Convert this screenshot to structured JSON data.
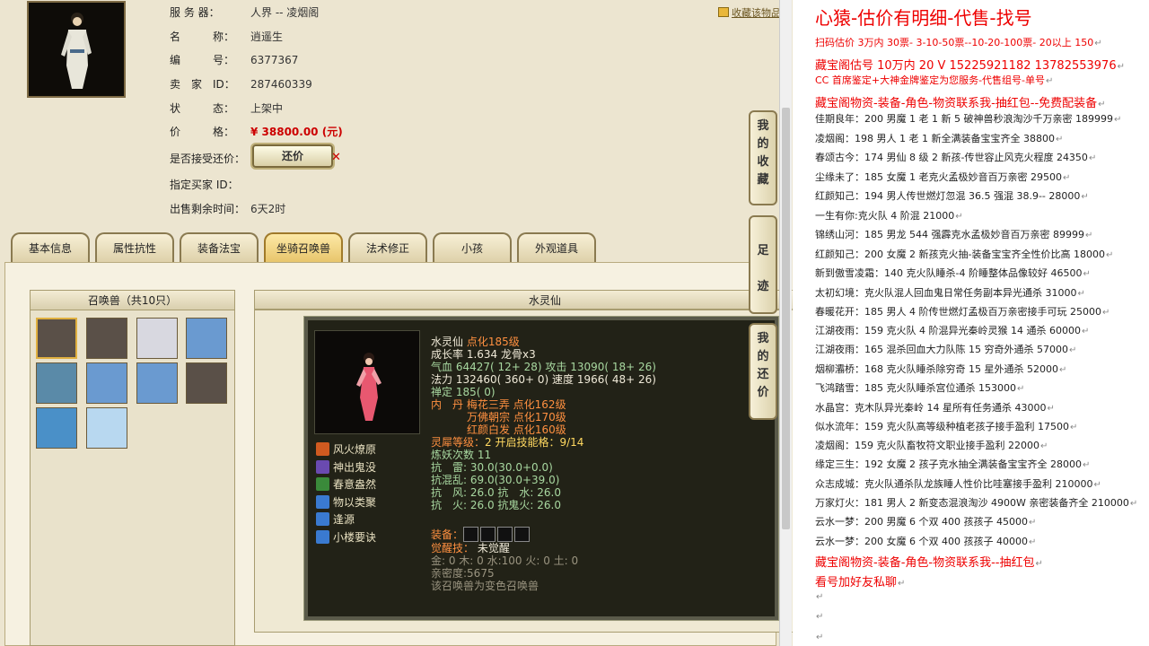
{
  "favorite_link": "收藏该物品",
  "char_info": {
    "server": {
      "label": "服 务 器：",
      "value": "人界 -- 凌烟阁"
    },
    "name": {
      "label": "名　　　称：",
      "value": "逍遥生"
    },
    "number": {
      "label": "编　　　号：",
      "value": "6377367"
    },
    "seller": {
      "label": "卖　家　ID：",
      "value": "287460339"
    },
    "status": {
      "label": "状　　　态：",
      "value": "上架中"
    },
    "price": {
      "label": "价　　　格：",
      "value": "¥ 38800.00 (元)"
    },
    "counter_offer": {
      "label": "是否接受还价：",
      "button": "还价"
    },
    "buyer": {
      "label": "指定买家 ID：",
      "value": ""
    },
    "remaining": {
      "label": "出售剩余时间：",
      "value": "6天2时"
    }
  },
  "tabs": [
    "基本信息",
    "属性抗性",
    "装备法宝",
    "坐骑召唤兽",
    "法术修正",
    "小孩",
    "外观道具"
  ],
  "active_tab": "坐骑召唤兽",
  "side_tabs": [
    {
      "label": "我的收藏",
      "chars": [
        "我",
        "的",
        "收",
        "藏"
      ]
    },
    {
      "label": "足迹",
      "chars": [
        "足",
        "迹"
      ]
    },
    {
      "label": "我的还价",
      "chars": [
        "我",
        "的",
        "还",
        "价"
      ]
    }
  ],
  "pets": {
    "title": "召唤兽（共10只）",
    "count": 10
  },
  "detail": {
    "title": "水灵仙",
    "name": "水灵仙",
    "level": "点化185级",
    "growth": "成长率 1.634 龙骨x3",
    "hp": "气血 64427( 12+ 28)",
    "attack": "攻击 13090( 18+ 26)",
    "mp": "法力 132460( 360+ 0)",
    "speed": "速度 1966( 48+ 26)",
    "ding": "禅定 185( 0)",
    "dan_label": "内　丹",
    "dan1": "梅花三弄 点化162级",
    "dan2": "万佛朝宗 点化170级",
    "dan3": "红颜白发 点化160级",
    "lingshou_label": "灵犀等级：",
    "lingshou_value": "2 开启技能格：9/14",
    "lianyao": "炼妖次数 11",
    "res1": "抗　雷: 30.0(30.0+0.0)",
    "res2": "抗混乱: 69.0(30.0+39.0)",
    "res3": "抗　风: 26.0  抗　水: 26.0",
    "res4": "抗　火: 26.0  抗鬼火: 26.0",
    "equip_label": "装备：",
    "awake_label": "觉醒技：",
    "awake_value": "未觉醒",
    "elements": "金: 0 木: 0 水:100 火: 0 土: 0",
    "intimacy": "亲密度:5675",
    "note": "该召唤兽为变色召唤兽",
    "skills": [
      "风火燎原",
      "神出鬼没",
      "春意盎然",
      "物以类聚",
      "逢源",
      "小楼要诀"
    ],
    "skill_colors": [
      "#d05a20",
      "#6a4ab0",
      "#3a8a3a",
      "#3a7ad0",
      "#3a7ad0",
      "#3a7ad0"
    ]
  },
  "right_panel": {
    "header": "心猿-估价有明细-代售-找号",
    "watermark": "",
    "lines": [
      {
        "text": "扫码估价 3万内 30票- 3-10-50票--10-20-100票-  20以上 150",
        "style": "red"
      },
      {
        "text": "藏宝阁估号 10万内 20 V 15225921182   13782553976",
        "style": "red mid"
      },
      {
        "text": "CC 首席鉴定+大神金牌鉴定为您服务-代售组号-单号",
        "style": "red"
      },
      {
        "text": "藏宝阁物资-装备-角色-物资联系我-抽红包--免费配装备",
        "style": "red mid"
      },
      {
        "text": "佳期良年：200 男魔 1 老 1 新 5 破神兽秒浪淘沙千万亲密 189999",
        "style": ""
      },
      {
        "text": "凌烟阁：198 男人 1 老 1 新全满装备宝宝齐全 38800",
        "style": ""
      },
      {
        "text": "春颂古今：174 男仙 8 级 2 新孩-传世容止风克火程度 24350",
        "style": ""
      },
      {
        "text": "尘缘未了：185 女魔 1 老克火孟极妙音百万亲密 29500",
        "style": ""
      },
      {
        "text": "红颜知己：194 男人传世燃灯忽混 36.5 强混 38.9-- 28000",
        "style": ""
      },
      {
        "text": "一生有你:克火队 4 阶混 21000",
        "style": ""
      },
      {
        "text": "锦绣山河：185 男龙 544 强霹克水孟极妙音百万亲密 89999",
        "style": ""
      },
      {
        "text": "红颜知己：200 女魔 2 新孩克火抽-装备宝宝齐全性价比高 18000",
        "style": ""
      },
      {
        "text": "新到傲雪凌霜：140 克火队睡杀-4 阶睡整体品像较好 46500",
        "style": ""
      },
      {
        "text": "太初幻境：克火队混人回血鬼日常任务副本异光通杀 31000",
        "style": ""
      },
      {
        "text": "春暖花开：185 男人 4 阶传世燃灯孟极百万亲密接手可玩 25000",
        "style": ""
      },
      {
        "text": "江湖夜雨：159 克火队 4 阶混异光秦岭灵猴 14 通杀 60000",
        "style": ""
      },
      {
        "text": "江湖夜雨：165 混杀回血大力队陈 15 穷奇外通杀 57000",
        "style": ""
      },
      {
        "text": "烟柳灞桥：168 克火队睡杀除穷奇 15 星外通杀 52000",
        "style": ""
      },
      {
        "text": "飞鸿踏雪：185 克火队睡杀宫位通杀 153000",
        "style": ""
      },
      {
        "text": "水晶宫：克木队异光秦岭 14 星所有任务通杀 43000",
        "style": ""
      },
      {
        "text": "似水流年：159 克火队高等级种植老孩子接手盈利 17500",
        "style": ""
      },
      {
        "text": "凌烟阁：159 克火队畜牧符文职业接手盈利 22000",
        "style": ""
      },
      {
        "text": "缘定三生：192 女魔 2 孩子克水抽全满装备宝宝齐全 28000",
        "style": ""
      },
      {
        "text": "众志成城：克火队通杀队龙族睡人性价比哇塞接手盈利 210000",
        "style": ""
      },
      {
        "text": "万家灯火：181 男人 2 新变态混浪淘沙 4900W 亲密装备齐全 210000",
        "style": ""
      },
      {
        "text": "云水一梦：200 男魔 6 个双 400 孩孩子 45000",
        "style": ""
      },
      {
        "text": "云水一梦：200 女魔 6 个双 400 孩孩子 40000",
        "style": ""
      },
      {
        "text": "藏宝阁物资-装备-角色-物资联系我--抽红包",
        "style": "red mid"
      },
      {
        "text": "看号加好友私聊",
        "style": "red mid"
      }
    ]
  }
}
